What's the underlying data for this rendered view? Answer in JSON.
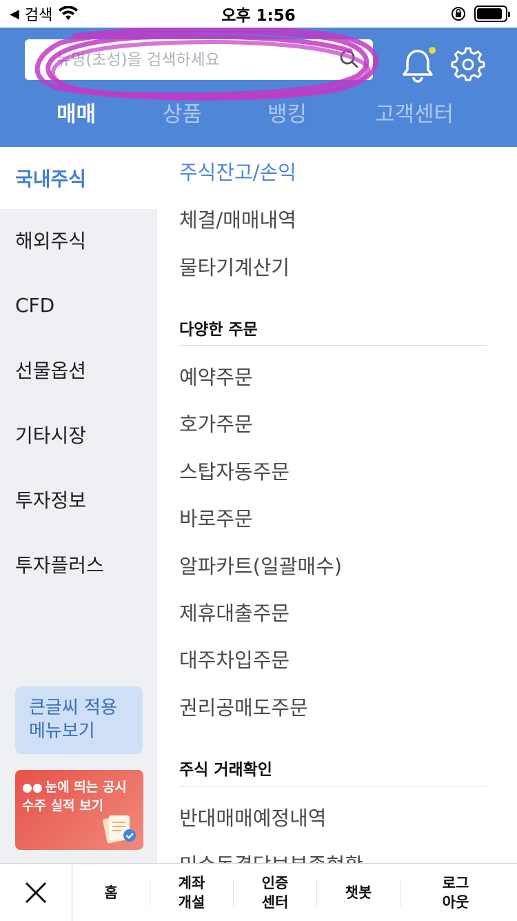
{
  "status_bar": {
    "back_label": "검색",
    "time": "오후 1:56",
    "battery_level": 0.9
  },
  "header": {
    "search_placeholder": "뉴명(초성)을 검색하세요",
    "notification_dot_color": "#f5d43a",
    "accent_color": "#4f86d8",
    "tabs": [
      {
        "label": "매매",
        "active": true
      },
      {
        "label": "상품",
        "active": false
      },
      {
        "label": "뱅킹",
        "active": false
      },
      {
        "label": "고객센터",
        "active": false
      }
    ]
  },
  "sidebar": {
    "items": [
      {
        "label": "국내주식",
        "active": true
      },
      {
        "label": "해외주식",
        "active": false
      },
      {
        "label": "CFD",
        "active": false
      },
      {
        "label": "선물옵션",
        "active": false
      },
      {
        "label": "기타시장",
        "active": false
      },
      {
        "label": "투자정보",
        "active": false
      },
      {
        "label": "투자플러스",
        "active": false
      }
    ],
    "bigfont_button": {
      "line1": "큰글씨 적용",
      "line2": "메뉴보기"
    },
    "promo": {
      "line1": "눈에 띄는 공시",
      "line2": "수주 실적 보기"
    }
  },
  "content": {
    "links_top": [
      "주식잔고/손익",
      "체결/매매내역",
      "물타기계산기"
    ],
    "section1_title": "다양한 주문",
    "links_orders": [
      "예약주문",
      "호가주문",
      "스탑자동주문",
      "바로주문",
      "알파카트(일괄매수)",
      "제휴대출주문",
      "대주차입주문",
      "권리공매도주문"
    ],
    "section2_title": "주식 거래확인",
    "links_trade": [
      "반대매매예정내역",
      "미수동결담보부족현황"
    ]
  },
  "bottom_bar": {
    "items": [
      "홈",
      "계좌\n개설",
      "인증\n센터",
      "챗봇",
      "로그\n아웃"
    ]
  }
}
